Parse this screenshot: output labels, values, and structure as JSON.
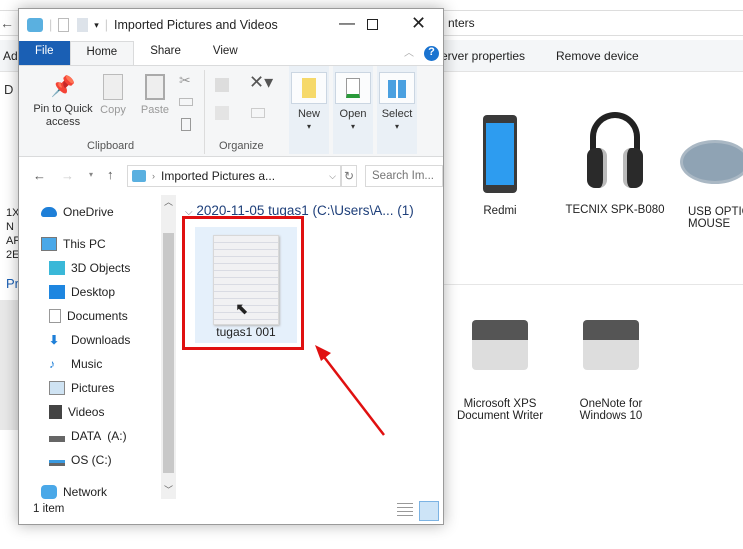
{
  "background": {
    "address_text": "nters",
    "toolbar": {
      "server_properties": "erver properties",
      "remove_device": "Remove device"
    },
    "left_fragments": [
      "Ad",
      "D",
      "1X",
      "N",
      "AF",
      "2E",
      "Pr"
    ],
    "devices": [
      {
        "label": "Redmi",
        "icon": "phone-icon"
      },
      {
        "label": "TECNIX SPK-B080",
        "icon": "headphones-icon"
      },
      {
        "label": "USB OPTIC\nMOUSE",
        "icon": "mouse-icon"
      }
    ],
    "printers": [
      {
        "label": "Microsoft XPS Document Writer",
        "icon": "printer-icon"
      },
      {
        "label": "OneNote for Windows 10",
        "icon": "printer-icon"
      }
    ]
  },
  "window": {
    "title": "Imported Pictures and Videos",
    "tabs": [
      {
        "label": "File"
      },
      {
        "label": "Home"
      },
      {
        "label": "Share"
      },
      {
        "label": "View"
      }
    ],
    "ribbon": {
      "pin": "Pin to Quick access",
      "copy": "Copy",
      "paste": "Paste",
      "clipboard": "Clipboard",
      "organize": "Organize",
      "new": "New",
      "open": "Open",
      "select": "Select"
    },
    "address": {
      "path": "Imported Pictures a...",
      "search_placeholder": "Search Im..."
    },
    "nav": [
      {
        "label": "OneDrive",
        "icon": "cloud-icon"
      },
      {
        "label": "This PC",
        "icon": "computer-icon"
      },
      {
        "label": "3D Objects",
        "icon": "cube-icon"
      },
      {
        "label": "Desktop",
        "icon": "desktop-icon"
      },
      {
        "label": "Documents",
        "icon": "document-icon"
      },
      {
        "label": "Downloads",
        "icon": "download-icon"
      },
      {
        "label": "Music",
        "icon": "music-icon"
      },
      {
        "label": "Pictures",
        "icon": "pictures-icon"
      },
      {
        "label": "Videos",
        "icon": "video-icon"
      },
      {
        "label": "DATA  (A:)",
        "icon": "drive-icon"
      },
      {
        "label": "OS (C:)",
        "icon": "drive-icon"
      },
      {
        "label": "Network",
        "icon": "network-icon"
      }
    ],
    "group_header": "2020-11-05 tugas1 (C:\\Users\\A... (1)",
    "file": {
      "name": "tugas1 001"
    },
    "status": "1 item"
  },
  "colors": {
    "highlight": "#e01010",
    "file_tab": "#1a5fb4",
    "selection": "#e5f0fb"
  }
}
